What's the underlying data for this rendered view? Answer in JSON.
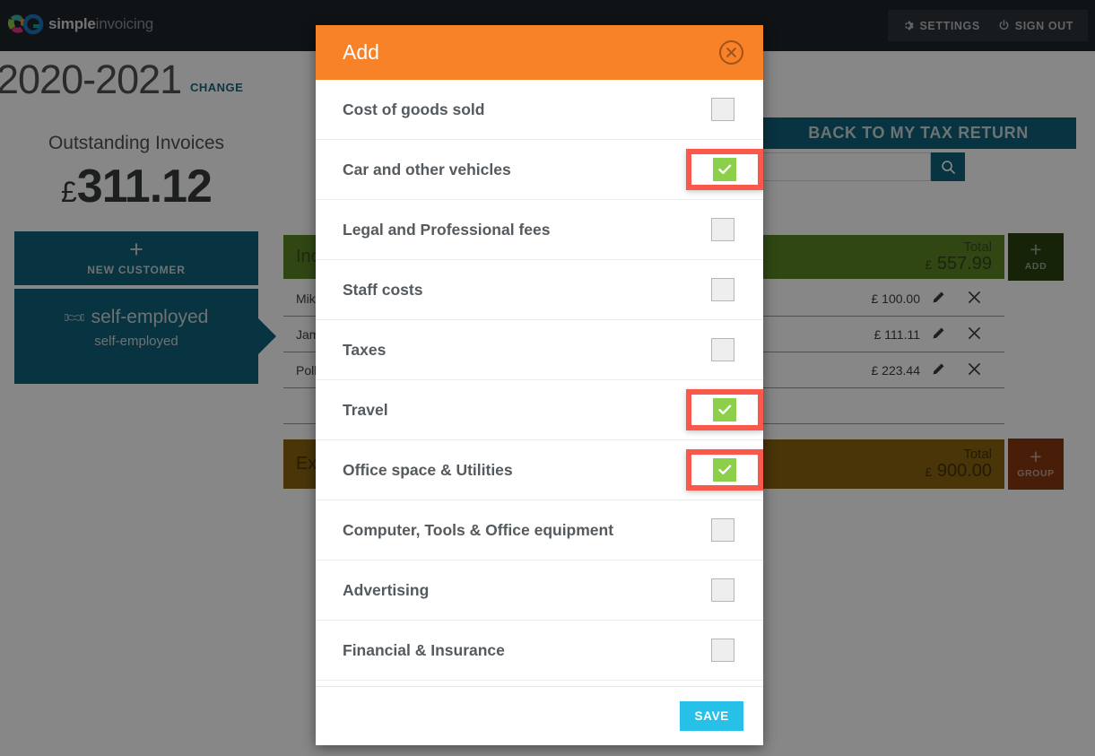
{
  "brand": {
    "name_bold": "simple",
    "name_light": "invoicing",
    "accent_orange": "#f78227",
    "accent_teal": "#10607c",
    "accent_green": "#8bcf4b",
    "highlight_red": "#f9584b",
    "save_blue": "#26c0e8"
  },
  "topnav": {
    "settings_label": "SETTINGS",
    "signout_label": "SIGN OUT"
  },
  "yearbar": {
    "year": "2020-2021",
    "change_label": "CHANGE",
    "back_button": "BACK TO MY TAX RETURN"
  },
  "sidebar": {
    "outstanding_label": "Outstanding Invoices",
    "outstanding_currency": "£",
    "outstanding_amount": "311.12",
    "new_customer_label": "NEW CUSTOMER",
    "new_customer_plus": "+",
    "customer_name": "self-employed",
    "customer_sub": "self-employed"
  },
  "search": {
    "value": "",
    "placeholder": ""
  },
  "income": {
    "title": "Income",
    "total_label": "Total",
    "total_currency": "£",
    "total_amount": "557.99",
    "add_label": "ADD",
    "add_plus": "+",
    "rows": [
      {
        "name": "Mike",
        "currency": "£",
        "amount": "100.00"
      },
      {
        "name": "James",
        "currency": "£",
        "amount": "111.11"
      },
      {
        "name": "Polly",
        "currency": "£",
        "amount": "223.44"
      }
    ]
  },
  "expenses": {
    "title": "Expenses",
    "total_label": "Total",
    "total_currency": "£",
    "total_amount": "900.00",
    "group_label": "GROUP",
    "group_plus": "+"
  },
  "modal": {
    "title": "Add",
    "close_glyph": "✕",
    "save_label": "SAVE",
    "items": [
      {
        "label": "Cost of goods sold",
        "checked": false,
        "highlighted": false
      },
      {
        "label": "Car and other vehicles",
        "checked": true,
        "highlighted": true
      },
      {
        "label": "Legal and Professional fees",
        "checked": false,
        "highlighted": false
      },
      {
        "label": "Staff costs",
        "checked": false,
        "highlighted": false
      },
      {
        "label": "Taxes",
        "checked": false,
        "highlighted": false
      },
      {
        "label": "Travel",
        "checked": true,
        "highlighted": true
      },
      {
        "label": "Office space & Utilities",
        "checked": true,
        "highlighted": true
      },
      {
        "label": "Computer, Tools & Office equipment",
        "checked": false,
        "highlighted": false
      },
      {
        "label": "Advertising",
        "checked": false,
        "highlighted": false
      },
      {
        "label": "Financial & Insurance",
        "checked": false,
        "highlighted": false
      }
    ]
  }
}
